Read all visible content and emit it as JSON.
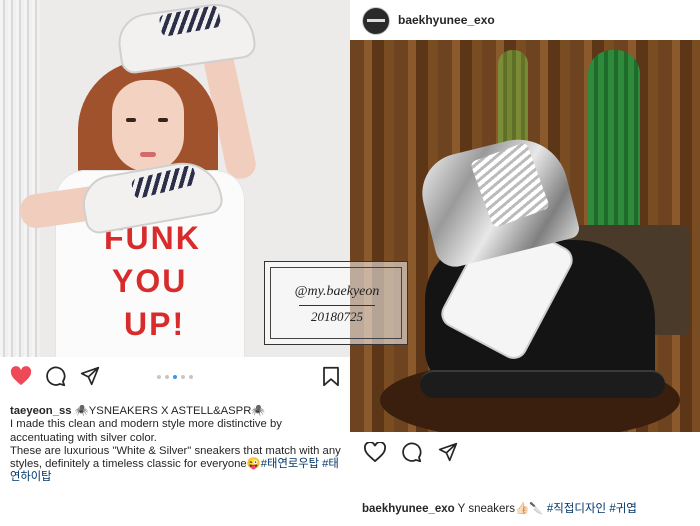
{
  "colors": {
    "like_red": "#ed4956",
    "hashtag_blue": "#003569",
    "dot_active": "#3897f0",
    "shirt_text": "#d82c2c"
  },
  "left_post": {
    "shirt_text": [
      "FUNK",
      "YOU",
      "UP!"
    ],
    "carousel": {
      "count": 5,
      "active": 2
    },
    "actions": {
      "liked": true,
      "icons": [
        "heart-icon",
        "comment-icon",
        "share-icon",
        "bookmark-icon"
      ]
    },
    "caption": {
      "username": "taeyeon_ss",
      "title": "🕷️YSNEAKERS X ASTELL&ASPR🕷️",
      "line1": "I made this clean and modern style more distinctive by accentuating with silver color.",
      "line2": "These are luxurious \"White & Silver\" sneakers that match with any styles, definitely a timeless classic for everyone😜",
      "tags": "#태연로우탑 #태연하이탑"
    }
  },
  "watermark": {
    "line1": "@my.baekyeon",
    "line2": "20180725"
  },
  "right_post": {
    "username": "baekhyunee_exo",
    "actions": {
      "icons": [
        "heart-icon",
        "comment-icon",
        "share-icon"
      ]
    },
    "caption": {
      "username": "baekhyunee_exo",
      "text": " Y sneakers👍🏻🔪 ",
      "tags": "#직접디자인 #귀엽"
    }
  }
}
